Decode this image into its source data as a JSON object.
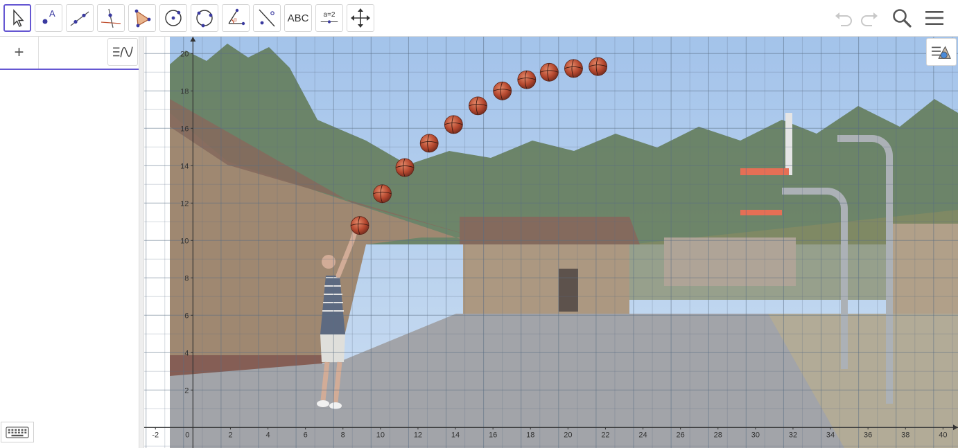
{
  "toolbar": {
    "tools": [
      {
        "name": "move-tool",
        "label": ""
      },
      {
        "name": "point-tool",
        "label": "A"
      },
      {
        "name": "line-tool",
        "label": ""
      },
      {
        "name": "perpendicular-line-tool",
        "label": ""
      },
      {
        "name": "polygon-tool",
        "label": ""
      },
      {
        "name": "circle-center-point-tool",
        "label": ""
      },
      {
        "name": "circle-three-points-tool",
        "label": ""
      },
      {
        "name": "angle-tool",
        "label": "α"
      },
      {
        "name": "reflect-tool",
        "label": ""
      },
      {
        "name": "text-tool",
        "label": "ABC"
      },
      {
        "name": "slider-tool",
        "label": "a=2"
      },
      {
        "name": "move-graphics-view-tool",
        "label": ""
      }
    ],
    "selected_tool": "move-tool",
    "right_buttons": [
      "undo-icon",
      "redo-icon",
      "search-icon",
      "menu-icon"
    ]
  },
  "algebra": {
    "add_label": "+"
  },
  "graphics": {
    "x_ticks": [
      "-2",
      "0",
      "2",
      "4",
      "6",
      "8",
      "10",
      "12",
      "14",
      "16",
      "18",
      "20",
      "22",
      "24",
      "26",
      "28",
      "30",
      "32",
      "34",
      "36",
      "38",
      "40"
    ],
    "y_ticks": [
      "2",
      "4",
      "6",
      "8",
      "10",
      "12",
      "14",
      "16",
      "18",
      "20"
    ],
    "x_range": [
      -2.6,
      40.8
    ],
    "y_range": [
      -1.1,
      20.9
    ],
    "grid": true,
    "background_image": "basketball shot photo",
    "ball_positions": [
      {
        "x": 8.9,
        "y": 10.8
      },
      {
        "x": 10.1,
        "y": 12.5
      },
      {
        "x": 11.3,
        "y": 13.9
      },
      {
        "x": 12.6,
        "y": 15.2
      },
      {
        "x": 13.9,
        "y": 16.2
      },
      {
        "x": 15.2,
        "y": 17.2
      },
      {
        "x": 16.5,
        "y": 18.0
      },
      {
        "x": 17.8,
        "y": 18.6
      },
      {
        "x": 19.0,
        "y": 19.0
      },
      {
        "x": 20.3,
        "y": 19.2
      },
      {
        "x": 21.6,
        "y": 19.3
      }
    ],
    "colors": {
      "accent": "#6557d2",
      "axis": "#333333",
      "sky": "#a8c8ec",
      "ball": "#c45538"
    }
  }
}
